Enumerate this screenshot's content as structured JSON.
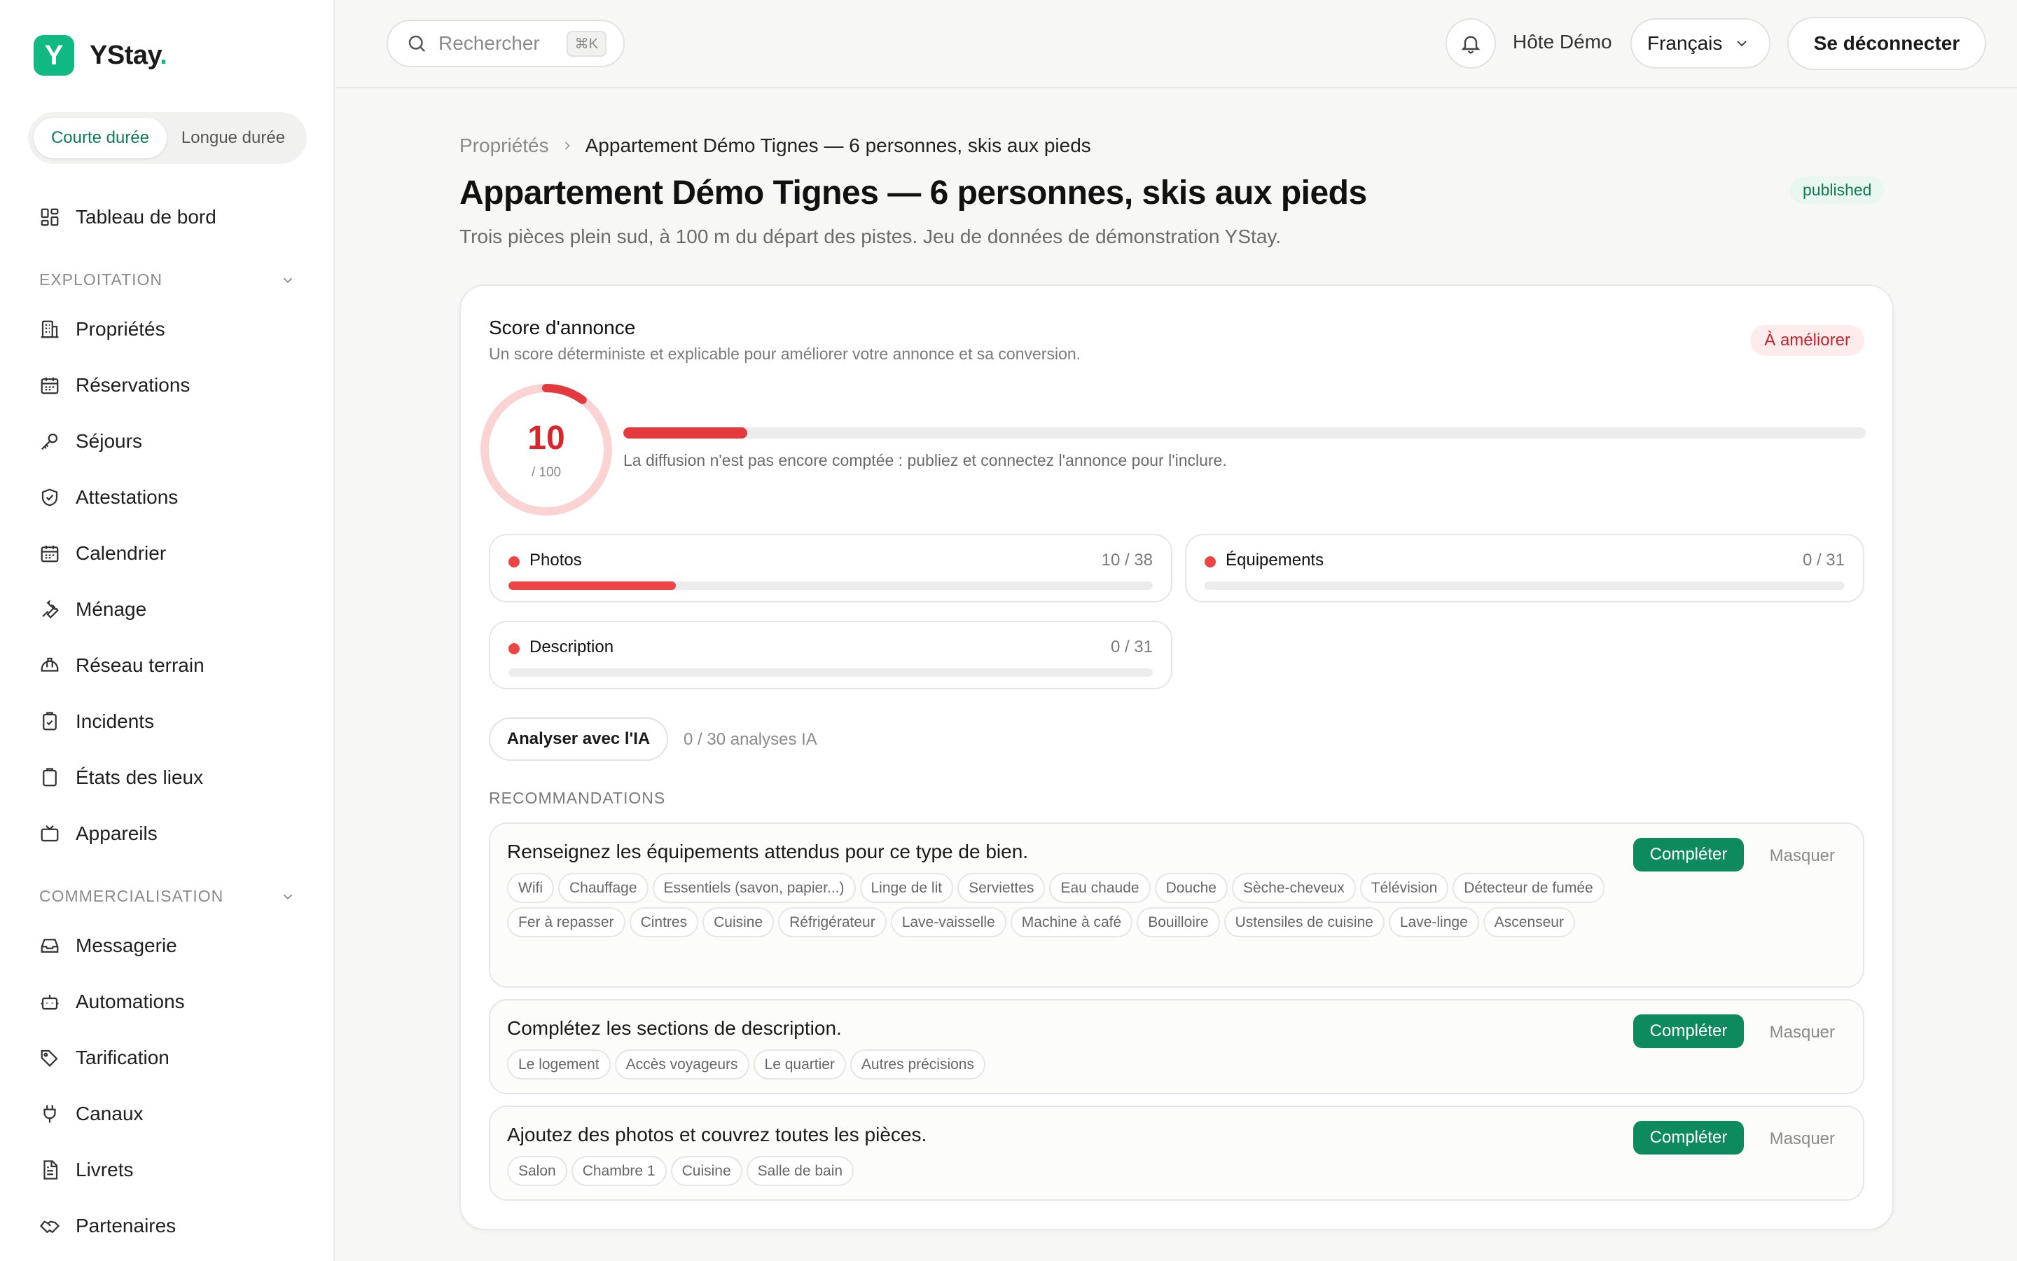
{
  "brand": {
    "name": "YStay",
    "dot": ".",
    "logo_letter": "Y"
  },
  "duration_toggle": {
    "short": "Courte durée",
    "long": "Longue durée"
  },
  "sidebar": {
    "dashboard": "Tableau de bord",
    "section_exploitation": "EXPLOITATION",
    "exploitation": [
      "Propriétés",
      "Réservations",
      "Séjours",
      "Attestations",
      "Calendrier",
      "Ménage",
      "Réseau terrain",
      "Incidents",
      "États des lieux",
      "Appareils"
    ],
    "section_commercialisation": "COMMERCIALISATION",
    "commercialisation": [
      "Messagerie",
      "Automations",
      "Tarification",
      "Canaux",
      "Livrets",
      "Partenaires"
    ]
  },
  "topbar": {
    "search_placeholder": "Rechercher",
    "search_shortcut": "⌘K",
    "host_name": "Hôte Démo",
    "language": "Français",
    "logout": "Se déconnecter"
  },
  "breadcrumb": {
    "parent": "Propriétés",
    "current": "Appartement Démo Tignes — 6 personnes, skis aux pieds"
  },
  "page": {
    "title": "Appartement Démo Tignes — 6 personnes, skis aux pieds",
    "status": "published",
    "subtitle": "Trois pièces plein sud, à 100 m du départ des pistes. Jeu de données de démonstration YStay."
  },
  "score": {
    "title": "Score d'annonce",
    "subtitle": "Un score déterministe et explicable pour améliorer votre annonce et sa conversion.",
    "badge": "À améliorer",
    "value": "10",
    "max_label": "/ 100",
    "progress": 0.1,
    "note": "La diffusion n'est pas encore comptée : publiez et connectez l'annonce pour l'inclure.",
    "metrics": [
      {
        "label": "Photos",
        "count": "10 / 38",
        "progress": 0.26
      },
      {
        "label": "Équipements",
        "count": "0 / 31",
        "progress": 0
      },
      {
        "label": "Description",
        "count": "0 / 31",
        "progress": 0
      }
    ],
    "ai_button": "Analyser avec l'IA",
    "ai_count": "0 / 30 analyses IA"
  },
  "recommendations": {
    "heading": "RECOMMANDATIONS",
    "complete_label": "Compléter",
    "hide_label": "Masquer",
    "items": [
      {
        "title": "Renseignez les équipements attendus pour ce type de bien.",
        "tags": [
          "Wifi",
          "Chauffage",
          "Essentiels (savon, papier...)",
          "Linge de lit",
          "Serviettes",
          "Eau chaude",
          "Douche",
          "Sèche-cheveux",
          "Télévision",
          "Détecteur de fumée",
          "Fer à repasser",
          "Cintres",
          "Cuisine",
          "Réfrigérateur",
          "Lave-vaisselle",
          "Machine à café",
          "Bouilloire",
          "Ustensiles de cuisine",
          "Lave-linge",
          "Ascenseur"
        ]
      },
      {
        "title": "Complétez les sections de description.",
        "tags": [
          "Le logement",
          "Accès voyageurs",
          "Le quartier",
          "Autres précisions"
        ]
      },
      {
        "title": "Ajoutez des photos et couvrez toutes les pièces.",
        "tags": [
          "Salon",
          "Chambre 1",
          "Cuisine",
          "Salle de bain"
        ]
      }
    ]
  },
  "colors": {
    "brand": "#10b981",
    "accent": "#0e8a5f",
    "danger": "#e43a3f"
  }
}
